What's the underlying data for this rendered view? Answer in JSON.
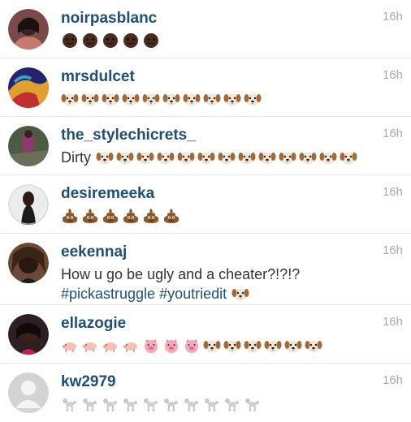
{
  "comments": [
    {
      "username": "noirpasblanc",
      "time": "16h",
      "avatar_color": "#6b3a3a",
      "avatar": "user-photo-avatar",
      "text": "",
      "hashtags": "",
      "emoji": "dark-face-emoji",
      "emoji_count": 5
    },
    {
      "username": "mrsdulcet",
      "time": "16h",
      "avatar_color": "#2a2f8a",
      "avatar": "user-photo-avatar",
      "text": "",
      "hashtags": "",
      "emoji": "dog-face-emoji",
      "emoji_count": 10
    },
    {
      "username": "the_stylechicrets_",
      "time": "16h",
      "avatar_color": "#3e4a3a",
      "avatar": "user-photo-avatar",
      "text": "Dirty",
      "hashtags": "",
      "emoji": "dog-face-emoji",
      "emoji_count": 13
    },
    {
      "username": "desiremeeka",
      "time": "16h",
      "avatar_color": "#cfcfcf",
      "avatar": "user-photo-avatar",
      "text": "",
      "hashtags": "",
      "emoji": "poop-emoji",
      "emoji_count": 6
    },
    {
      "username": "eekennaj",
      "time": "16h",
      "avatar_color": "#5a3a2a",
      "avatar": "user-photo-avatar",
      "text": "How u go be ugly and a cheater?!?!?",
      "hashtags": "#pickastruggle #youtriedit",
      "emoji": "dog-face-emoji",
      "emoji_count": 1
    },
    {
      "username": "ellazogie",
      "time": "16h",
      "avatar_color": "#2b2020",
      "avatar": "user-photo-avatar",
      "text": "",
      "hashtags": "",
      "emoji_groups": [
        {
          "emoji": "pig-emoji",
          "count": 4
        },
        {
          "emoji": "pig-face-emoji",
          "count": 3
        },
        {
          "emoji": "dog-face-emoji",
          "count": 6
        }
      ]
    },
    {
      "username": "kw2979",
      "time": "16h",
      "avatar_color": "#c8c8c8",
      "avatar": "default-avatar",
      "text": "",
      "hashtags": "",
      "emoji": "poodle-emoji",
      "emoji_count": 10
    }
  ],
  "colors": {
    "username": "#1f4f73",
    "time": "#a9a9a9",
    "text": "#333333",
    "divider": "#e6e6e6"
  }
}
